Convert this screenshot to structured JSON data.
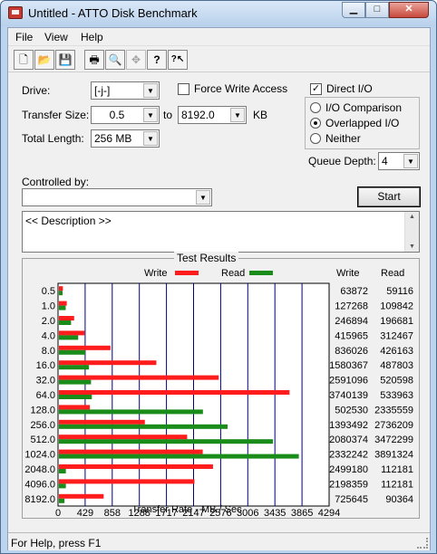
{
  "window": {
    "title": "Untitled - ATTO Disk Benchmark"
  },
  "menu": [
    "File",
    "View",
    "Help"
  ],
  "toolbar": [
    {
      "icon": "new-file-icon",
      "glyph": "🗋"
    },
    {
      "icon": "open-folder-icon",
      "glyph": "📂"
    },
    {
      "icon": "save-icon",
      "glyph": "💾"
    },
    {
      "icon": "print-icon",
      "glyph": "🖶"
    },
    {
      "icon": "print-preview-icon",
      "glyph": "🔍"
    },
    {
      "icon": "move-icon",
      "glyph": "✥"
    },
    {
      "icon": "help-icon",
      "glyph": "?"
    },
    {
      "icon": "context-help-icon",
      "glyph": "?↖"
    }
  ],
  "form": {
    "drive_label": "Drive:",
    "drive_value": "[-j-]",
    "force_write_label": "Force Write Access",
    "force_write_checked": false,
    "direct_io_label": "Direct I/O",
    "direct_io_checked": true,
    "transfer_size_label": "Transfer Size:",
    "transfer_from": "0.5",
    "transfer_to_label": "to",
    "transfer_to": "8192.0",
    "transfer_unit": "KB",
    "total_length_label": "Total Length:",
    "total_length_value": "256 MB",
    "io_comparison_label": "I/O Comparison",
    "overlapped_io_label": "Overlapped I/O",
    "neither_label": "Neither",
    "selected_mode": "Overlapped I/O",
    "queue_depth_label": "Queue Depth:",
    "queue_depth_value": "4",
    "controlled_by_label": "Controlled by:",
    "controlled_by_value": "",
    "start_label": "Start",
    "description_text": "<< Description >>"
  },
  "results": {
    "title": "Test Results",
    "write_legend": "Write",
    "read_legend": "Read",
    "write_col": "Write",
    "read_col": "Read",
    "write_color": "#ff1c1c",
    "read_color": "#1a8c1a",
    "grid_color": "#000080",
    "xlabel": "Transfer Rate - MB / Sec",
    "x_ticks": [
      "0",
      "429",
      "858",
      "1288",
      "1717",
      "2147",
      "2576",
      "3006",
      "3435",
      "3865",
      "4294"
    ]
  },
  "chart_data": {
    "type": "bar",
    "title": "Test Results",
    "categories": [
      "0.5",
      "1.0",
      "2.0",
      "4.0",
      "8.0",
      "16.0",
      "32.0",
      "64.0",
      "128.0",
      "256.0",
      "512.0",
      "1024.0",
      "2048.0",
      "4096.0",
      "8192.0"
    ],
    "series": [
      {
        "name": "Write",
        "values": [
          63872,
          127268,
          246894,
          415965,
          836026,
          1580367,
          2591096,
          3740139,
          502530,
          1393492,
          2080374,
          2332242,
          2499180,
          2198359,
          725645
        ]
      },
      {
        "name": "Read",
        "values": [
          59116,
          109842,
          196681,
          312467,
          426163,
          487803,
          520598,
          533963,
          2335559,
          2736209,
          3472299,
          3891324,
          112181,
          112181,
          90364
        ]
      }
    ],
    "xlabel": "Transfer Rate - MB / Sec",
    "xlim": [
      0,
      4294
    ],
    "grid": true,
    "legend": "top"
  },
  "status": {
    "text": "For Help, press F1"
  }
}
